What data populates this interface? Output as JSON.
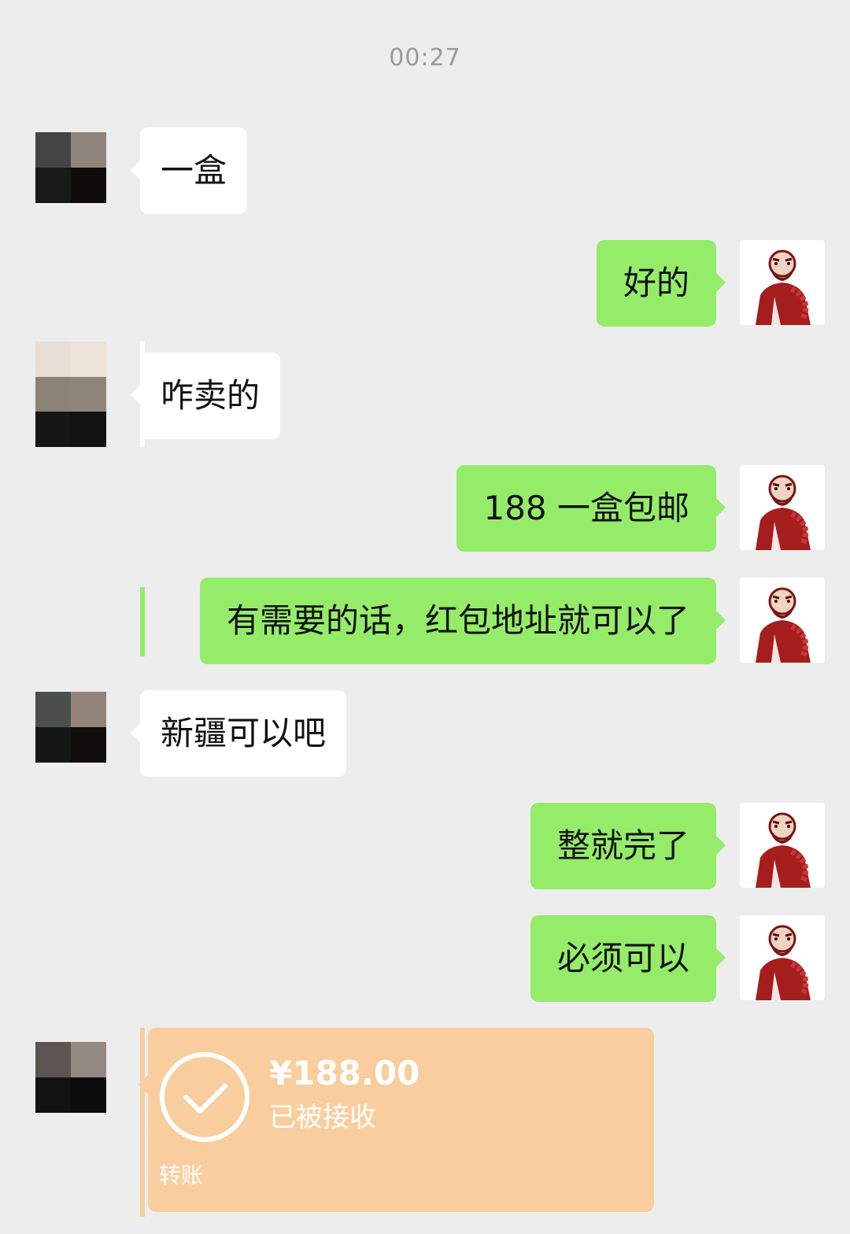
{
  "timestamp": "00:27",
  "messages": [
    {
      "side": "left",
      "text": "一盒"
    },
    {
      "side": "right",
      "text": "好的"
    },
    {
      "side": "left",
      "text": "咋卖的"
    },
    {
      "side": "right",
      "text": "188 一盒包邮"
    },
    {
      "side": "right",
      "text": "有需要的话，红包地址就可以了"
    },
    {
      "side": "left",
      "text": "新疆可以吧"
    },
    {
      "side": "right",
      "text": "整就完了"
    },
    {
      "side": "right",
      "text": "必须可以"
    }
  ],
  "transfer": {
    "amount": "¥188.00",
    "status": "已被接收",
    "label": "转账"
  },
  "colors": {
    "background": "#ededed",
    "bubble_self": "#95ec69",
    "bubble_other": "#ffffff",
    "transfer_card": "#f9cd9e",
    "timestamp_text": "#9a9a9a"
  },
  "icons": {
    "contact_avatar": "pixelated-avatar",
    "self_avatar": "red-monk-portrait-avatar",
    "transfer_status": "check-circle-icon"
  }
}
